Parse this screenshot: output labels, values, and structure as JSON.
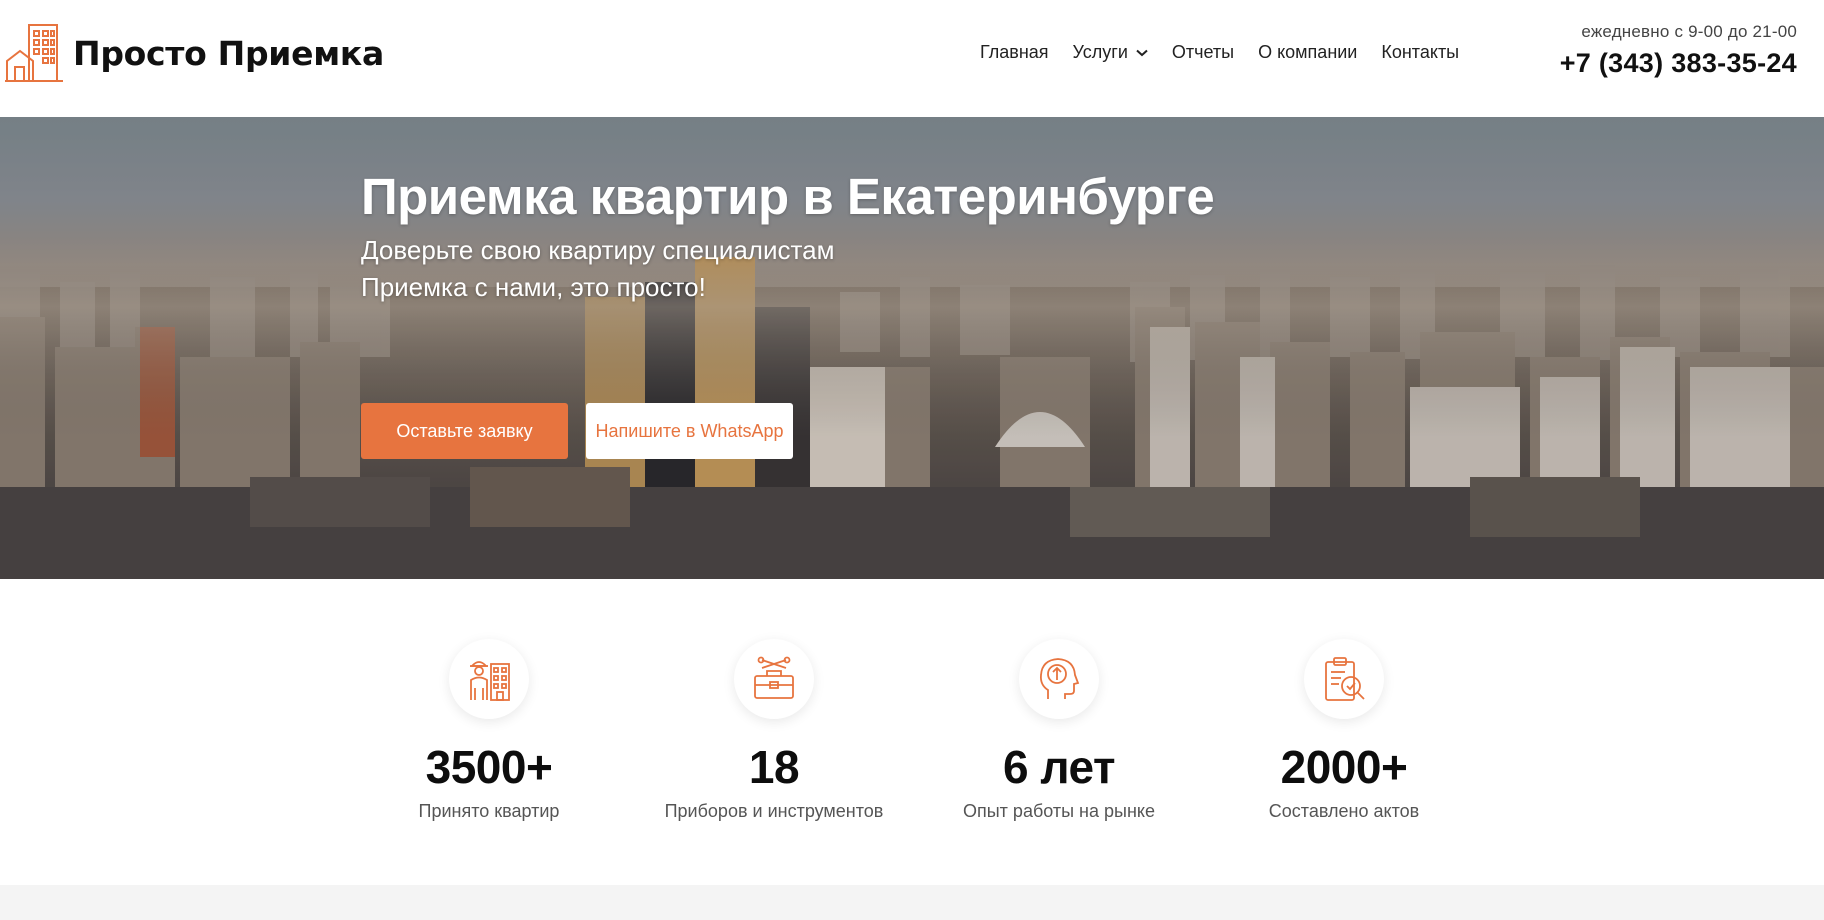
{
  "colors": {
    "accent": "#e7743f",
    "text": "#111111",
    "muted": "#555555"
  },
  "header": {
    "logo_text": "Просто Приемка",
    "logo_icon": "building-house-icon",
    "nav": [
      {
        "label": "Главная"
      },
      {
        "label": "Услуги",
        "has_dropdown": true
      },
      {
        "label": "Отчеты"
      },
      {
        "label": "О компании"
      },
      {
        "label": "Контакты"
      }
    ],
    "hours": "ежедневно с 9-00 до 21-00",
    "phone": "+7 (343) 383-35-24"
  },
  "hero": {
    "title": "Приемка квартир в Екатеринбурге",
    "subtitle_1": "Доверьте свою квартиру специалистам",
    "subtitle_2": "Приемка с нами, это просто!",
    "btn_primary": "Оставьте заявку",
    "btn_secondary": "Напишите в WhatsApp"
  },
  "stats": [
    {
      "icon": "worker-building-icon",
      "value": "3500+",
      "label": "Принято квартир"
    },
    {
      "icon": "toolbox-icon",
      "value": "18",
      "label": "Приборов и инструментов"
    },
    {
      "icon": "head-arrow-icon",
      "value": "6 лет",
      "label": "Опыт работы на рынке"
    },
    {
      "icon": "clipboard-check-icon",
      "value": "2000+",
      "label": "Составлено актов"
    }
  ]
}
